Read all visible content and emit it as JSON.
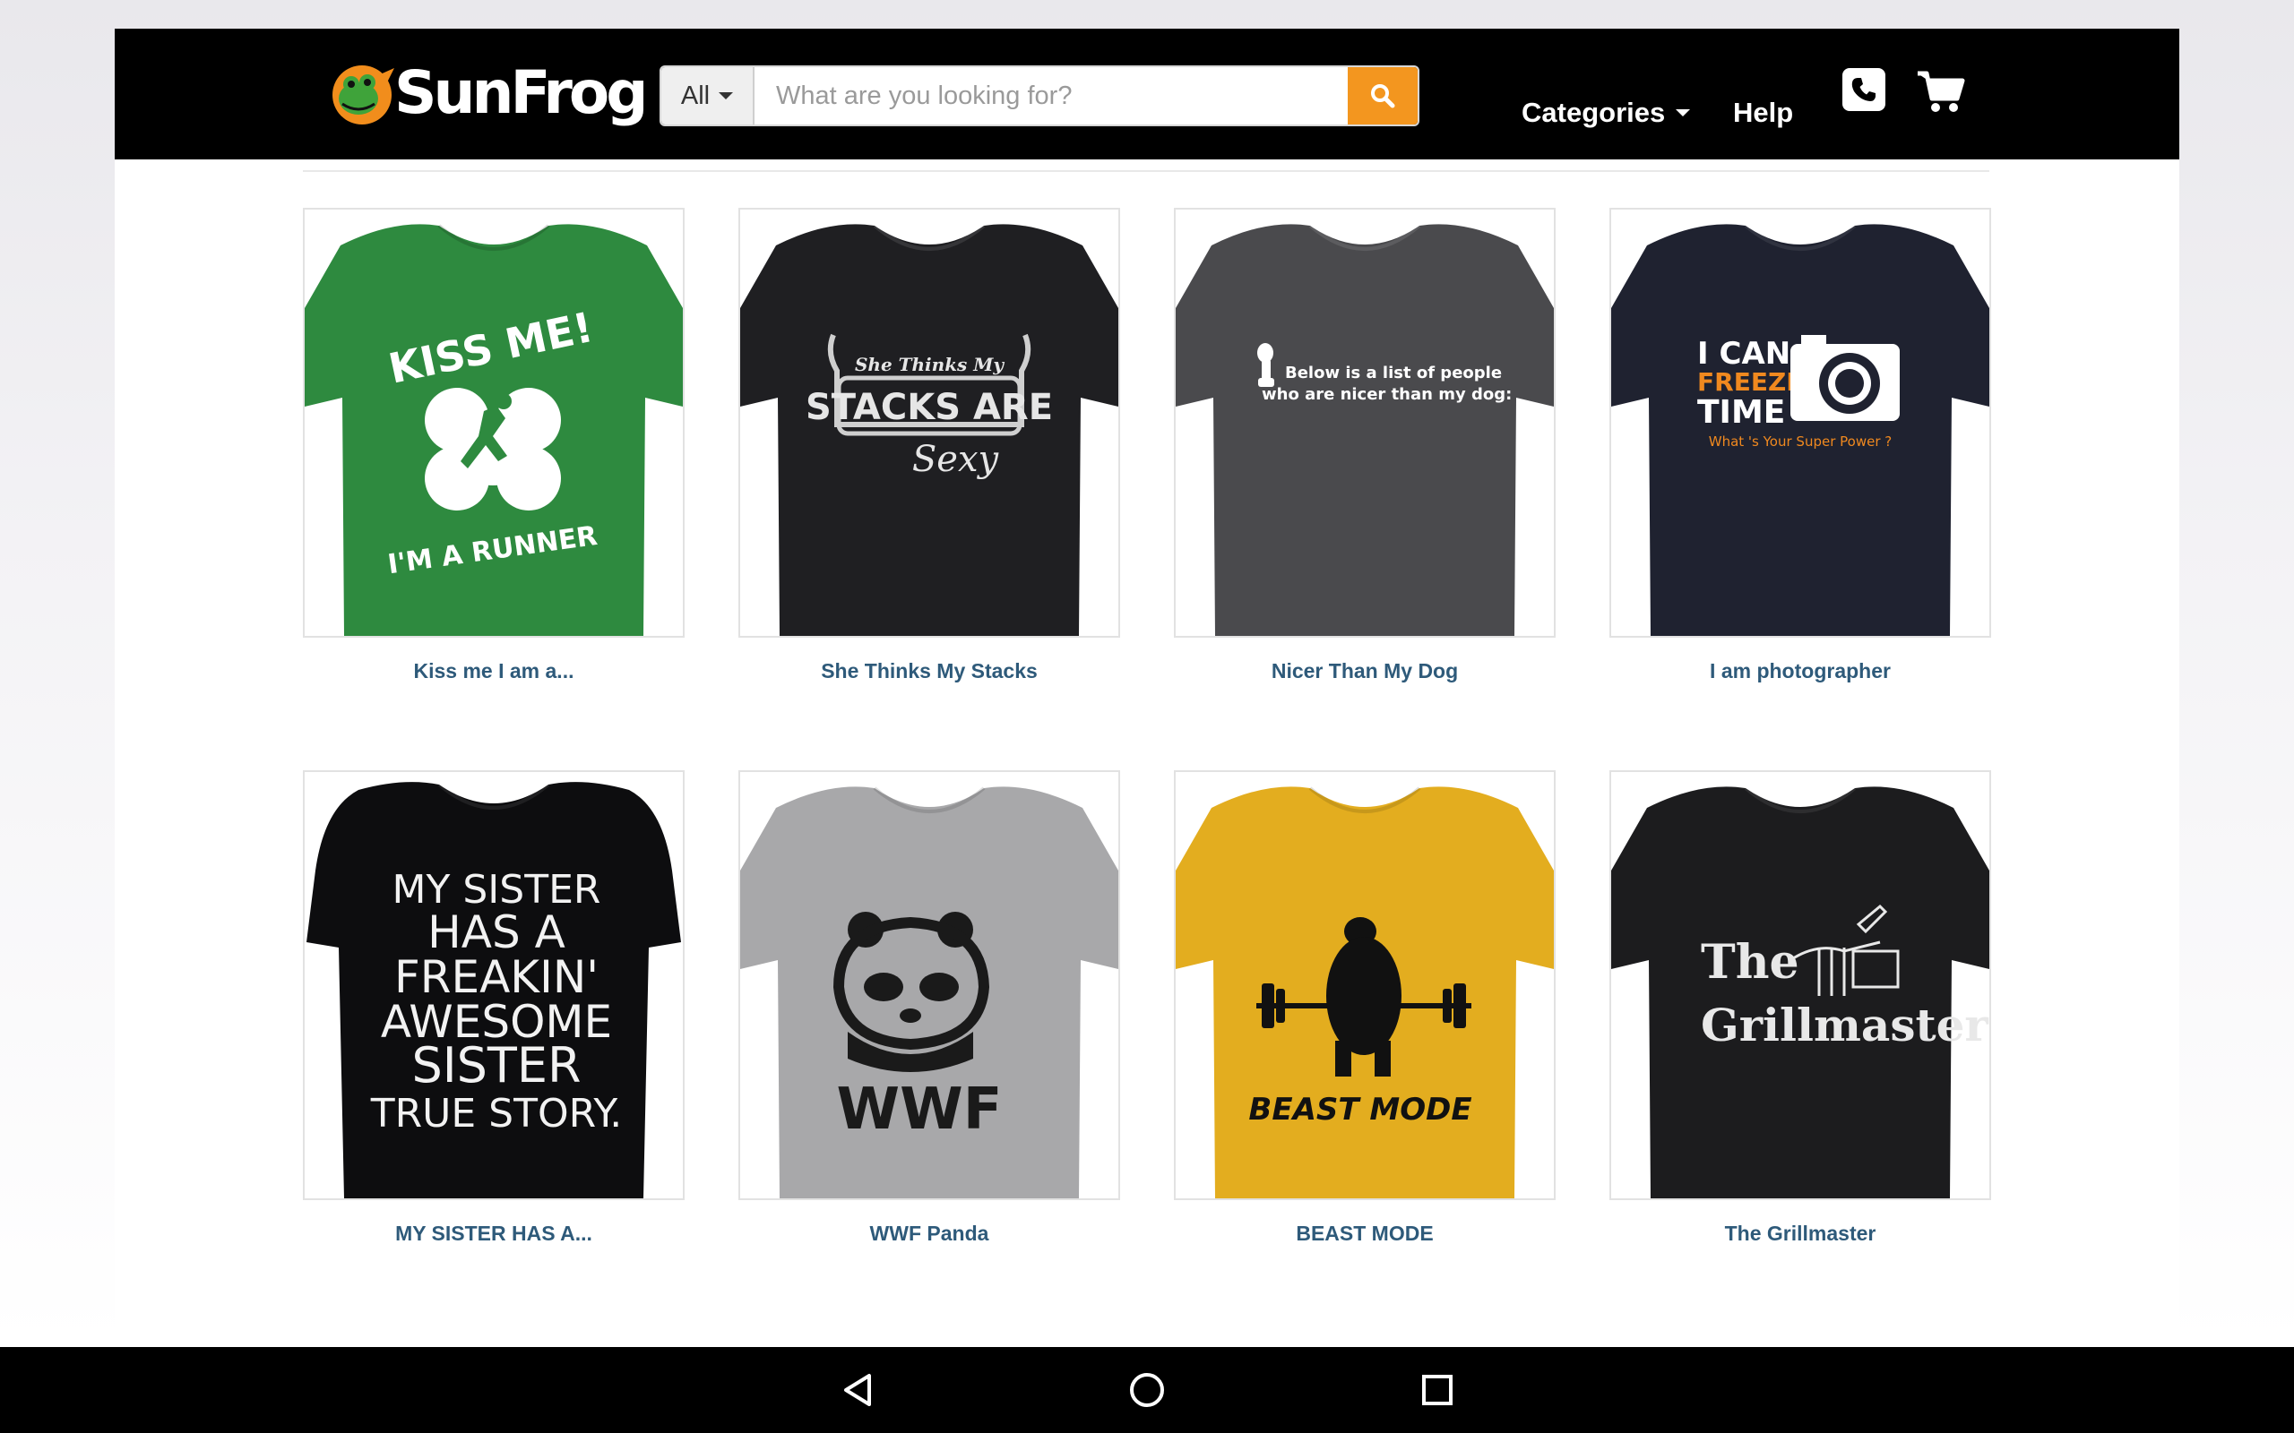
{
  "header": {
    "logo_text": "SunFrog",
    "search": {
      "scope_label": "All",
      "placeholder": "What are you looking for?"
    },
    "nav": {
      "categories_label": "Categories",
      "help_label": "Help"
    },
    "icons": [
      "frog-logo-icon",
      "search-icon",
      "phone-icon",
      "cart-icon"
    ]
  },
  "colors": {
    "header_bg": "#000000",
    "search_button": "#f3961f",
    "product_title": "#2e5a7a"
  },
  "products": [
    {
      "title": "Kiss me I am a...",
      "shirt_color": "#2e8a3f",
      "print": [
        "KISS ME!",
        "I'M A RUNNER"
      ],
      "print_color": "#ffffff"
    },
    {
      "title": "She Thinks My Stacks",
      "shirt_color": "#1f1f22",
      "print": [
        "She Thinks My",
        "STACKS ARE",
        "Sexy"
      ],
      "print_color": "#e6e6e6"
    },
    {
      "title": "Nicer Than My Dog",
      "shirt_color": "#4a4a4d",
      "print": [
        "Below is a list of people",
        "who are nicer than my dog:"
      ],
      "print_color": "#ffffff"
    },
    {
      "title": "I am photographer",
      "shirt_color": "#1f2230",
      "print": [
        "I CAN",
        "FREEZE",
        "TIME",
        "What 's Your Super Power ?"
      ],
      "print_color": "#ffffff",
      "accent_color": "#f0891f"
    },
    {
      "title": "MY SISTER HAS A...",
      "shirt_color": "#0d0d0f",
      "print": [
        "MY SISTER",
        "HAS A",
        "FREAKIN'",
        "AWESOME",
        "SISTER",
        "TRUE STORY."
      ],
      "print_color": "#f2f2f2"
    },
    {
      "title": "WWF Panda",
      "shirt_color": "#a8a8aa",
      "print": [
        "WWF"
      ],
      "print_color": "#1a1a1a"
    },
    {
      "title": "BEAST MODE",
      "shirt_color": "#e3ad1f",
      "print": [
        "BEAST MODE"
      ],
      "print_color": "#111111"
    },
    {
      "title": "The Grillmaster",
      "shirt_color": "#1c1c1e",
      "print": [
        "The",
        "Grillmaster"
      ],
      "print_color": "#e8e8e8"
    }
  ],
  "system_nav": {
    "icons": [
      "back-icon",
      "home-icon",
      "recents-icon"
    ]
  }
}
